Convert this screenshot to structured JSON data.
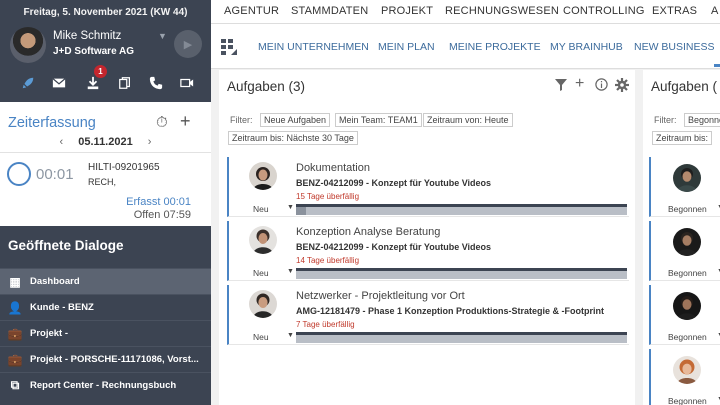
{
  "sidebar": {
    "date": "Freitag, 5. November 2021 (KW 44)",
    "user": {
      "name": "Mike Schmitz",
      "company": "J+D Software AG"
    },
    "icons": [
      {
        "name": "rocket-icon",
        "glyph": "🚀"
      },
      {
        "name": "mail-icon",
        "glyph": "✉"
      },
      {
        "name": "download-icon",
        "glyph": "⬇",
        "badge": "1"
      },
      {
        "name": "documents-icon",
        "glyph": "⧉"
      },
      {
        "name": "phone-icon",
        "glyph": "✆"
      },
      {
        "name": "video-icon",
        "glyph": "▶"
      }
    ],
    "zeiterfassung": {
      "title": "Zeiterfassung",
      "date": "05.11.2021",
      "time": "00:01",
      "code": "HILTI-09201965",
      "code_sub": "RECH,",
      "erfasst": "Erfasst 00:01",
      "offen": "Offen 07:59"
    },
    "dialogs": {
      "title": "Geöffnete Dialoge",
      "items": [
        {
          "label": "Dashboard",
          "icon": "grid-icon",
          "glyph": "▦",
          "active": true
        },
        {
          "label": "Kunde - BENZ",
          "icon": "person-icon",
          "glyph": "👤",
          "active": false
        },
        {
          "label": "Projekt -",
          "icon": "briefcase-icon",
          "glyph": "💼",
          "active": false
        },
        {
          "label": "Projekt - PORSCHE-11171086, Vorst...",
          "icon": "briefcase-icon",
          "glyph": "💼",
          "active": false
        },
        {
          "label": "Report Center - Rechnungsbuch",
          "icon": "report-icon",
          "glyph": "⧉",
          "active": false
        }
      ]
    }
  },
  "topnav": [
    "AGENTUR",
    "STAMMDATEN",
    "PROJEKT",
    "RECHNUNGSWESEN",
    "CONTROLLING",
    "EXTRAS",
    "A"
  ],
  "subnav": [
    "MEIN UNTERNEHMEN",
    "MEIN PLAN",
    "MEINE PROJEKTE",
    "MY BRAINHUB",
    "NEW BUSINESS"
  ],
  "panel1": {
    "title": "Aufgaben (3)",
    "filter_label": "Filter:",
    "chips": [
      "Neue Aufgaben",
      "Mein Team: TEAM1",
      "Zeitraum von: Heute",
      "Zeitraum bis: Nächste 30 Tage"
    ],
    "tasks": [
      {
        "name": "Dokumentation",
        "ref": "BENZ-04212099 - Konzept für Youtube Videos",
        "due": "15 Tage überfällig",
        "status": "Neu",
        "progress": 0.03
      },
      {
        "name": "Konzeption Analyse Beratung",
        "ref": "BENZ-04212099 - Konzept für Youtube Videos",
        "due": "14 Tage überfällig",
        "status": "Neu",
        "progress": 0
      },
      {
        "name": "Netzwerker - Projektleitung vor Ort",
        "ref": "AMG-12181479 - Phase 1 Konzeption Produktions-Strategie & -Footprint",
        "due": "7 Tage überfällig",
        "status": "Neu",
        "progress": 0
      }
    ]
  },
  "panel2": {
    "title": "Aufgaben (",
    "filter_label": "Filter:",
    "chips": [
      "Begonne",
      "Zeitraum bis:"
    ],
    "tasks": [
      {
        "status": "Begonnen"
      },
      {
        "status": "Begonnen"
      },
      {
        "status": "Begonnen"
      },
      {
        "status": "Begonnen"
      }
    ]
  }
}
